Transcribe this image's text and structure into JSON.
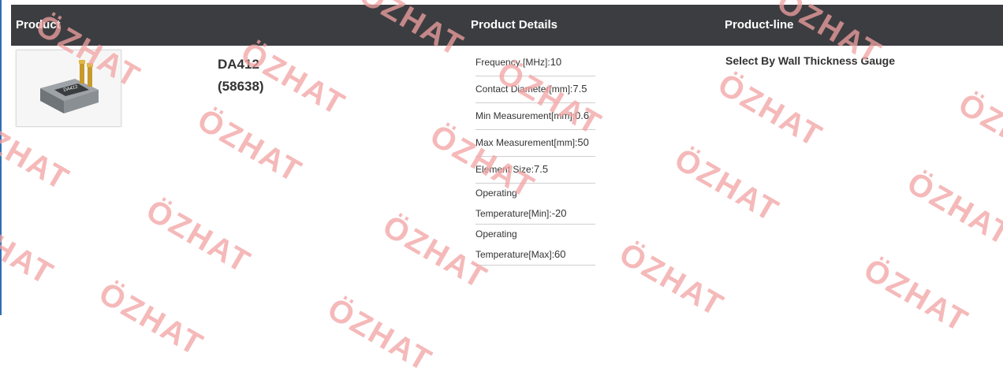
{
  "header": {
    "product": "Product",
    "details": "Product Details",
    "line": "Product-line"
  },
  "product": {
    "name": "DA412",
    "code": "(58638)",
    "label_on_image": "DA412",
    "sub_label_on_image": "CRN3"
  },
  "specs": [
    {
      "label": "Frequency [MHz]:",
      "value": "10"
    },
    {
      "label": "Contact Diameter[mm]:",
      "value": "7.5"
    },
    {
      "label": "Min Measurement[mm]:",
      "value": "0.6"
    },
    {
      "label": "Max Measurement[mm]:",
      "value": "50"
    },
    {
      "label": "Element Size:",
      "value": "7.5"
    },
    {
      "label_line1": "Operating",
      "label_line2": "Temperature[Min]:",
      "value": "-20"
    },
    {
      "label_line1": "Operating",
      "label_line2": "Temperature[Max]:",
      "value": "60"
    }
  ],
  "product_line": "Select By Wall Thickness Gauge",
  "watermark_text": "ÖZHAT",
  "colors": {
    "header_bg": "#3c3d41",
    "watermark": "#f2a2a2",
    "left_rule": "#2f6fb5"
  }
}
